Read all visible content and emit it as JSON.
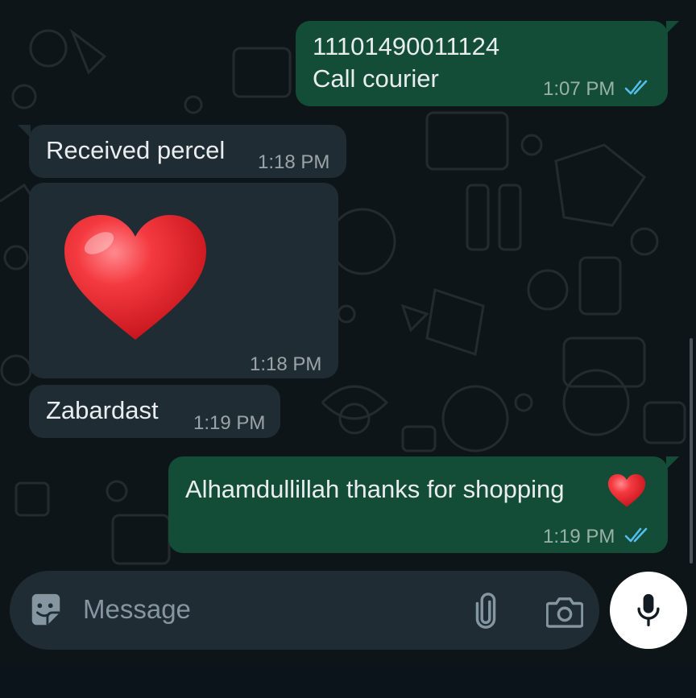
{
  "messages": [
    {
      "direction": "outgoing",
      "text_line1": "11101490011124",
      "text_line2": "Call courier",
      "time": "1:07 PM",
      "status": "read"
    },
    {
      "direction": "incoming",
      "text": "Received percel",
      "time": "1:18 PM"
    },
    {
      "direction": "incoming",
      "type": "emoji",
      "emoji": "red-heart",
      "time": "1:18 PM"
    },
    {
      "direction": "incoming",
      "text": "Zabardast",
      "time": "1:19 PM"
    },
    {
      "direction": "outgoing",
      "text": "Alhamdullillah thanks for shopping",
      "emoji": "red-heart",
      "time": "1:19 PM",
      "status": "read"
    }
  ],
  "composer": {
    "placeholder": "Message",
    "icons": [
      "sticker-icon",
      "paperclip-icon",
      "camera-icon",
      "microphone-icon"
    ]
  },
  "colors": {
    "background": "#0e1519",
    "outgoing_bubble": "#144d37",
    "incoming_bubble": "#1f2c33",
    "read_ticks": "#53bdeb",
    "heart": "#e8252b"
  }
}
